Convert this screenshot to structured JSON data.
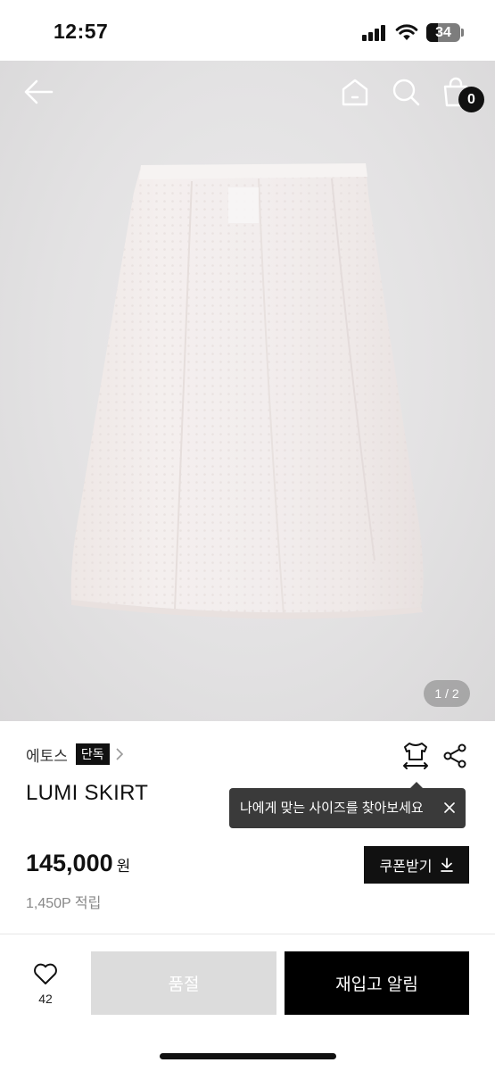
{
  "status_bar": {
    "time": "12:57",
    "battery": "34"
  },
  "header": {
    "cart_count": "0"
  },
  "gallery": {
    "page_indicator": "1 / 2"
  },
  "product": {
    "brand": "에토스",
    "exclusive_badge": "단독",
    "name": "LUMI SKIRT",
    "price": "145,000",
    "price_unit": "원",
    "points": "1,450P 적립"
  },
  "tooltip": {
    "text": "나에게 맞는 사이즈를 찾아보세요"
  },
  "coupon": {
    "label": "쿠폰받기"
  },
  "bottom_bar": {
    "like_count": "42",
    "soldout_label": "품절",
    "restock_label": "재입고 알림"
  },
  "icons": [
    "back-arrow-icon",
    "home-icon",
    "search-icon",
    "shopping-bag-icon",
    "chevron-right-icon",
    "size-guide-icon",
    "share-icon",
    "close-icon",
    "download-icon",
    "heart-icon",
    "signal-icon",
    "wifi-icon",
    "battery-icon"
  ]
}
